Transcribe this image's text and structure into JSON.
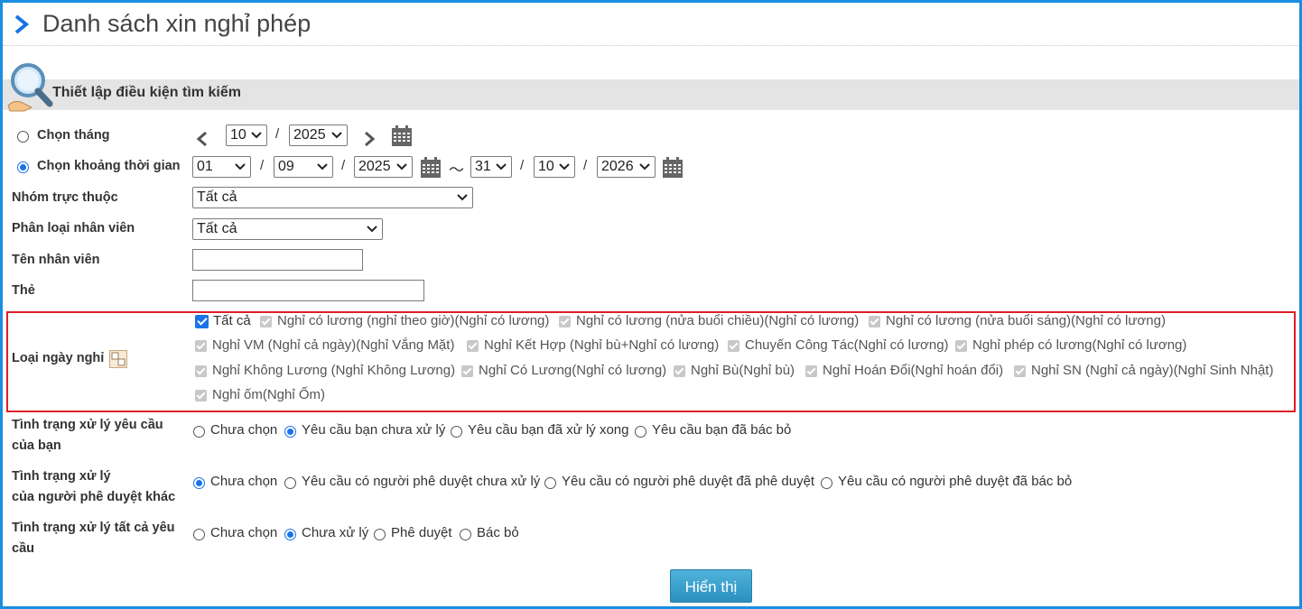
{
  "page": {
    "title": "Danh sách xin nghỉ phép",
    "section_title": "Thiết lập điều kiện tìm kiếm",
    "accent_color": "#1a8ee0",
    "highlight_color": "#e01e2a"
  },
  "month_mode": {
    "label": "Chọn tháng",
    "selected": false,
    "month": "10",
    "separator": "/",
    "year": "2025"
  },
  "range_mode": {
    "label": "Chọn khoảng thời gian",
    "selected": true,
    "from_day": "01",
    "from_month": "09",
    "from_year": "2025",
    "tilde": "～",
    "to_day": "31",
    "to_month": "10",
    "to_year": "2026",
    "separator": "/"
  },
  "group": {
    "label": "Nhóm trực thuộc",
    "value": "Tất cả"
  },
  "employee_type": {
    "label": "Phân loại nhân viên",
    "value": "Tất cả"
  },
  "employee_name": {
    "label": "Tên nhân viên",
    "value": ""
  },
  "card": {
    "label": "Thẻ",
    "value": ""
  },
  "leave_types": {
    "label": "Loại ngày nghỉ",
    "all_label": "Tất cả",
    "items": [
      "Nghỉ có lương (nghỉ theo giờ)(Nghỉ có lương)",
      "Nghỉ có lương (nửa buổi chiều)(Nghỉ có lương)",
      "Nghỉ có lương (nửa buổi sáng)(Nghỉ có lương)",
      "Nghỉ VM (Nghỉ cả ngày)(Nghỉ Vắng Mặt)",
      "Nghỉ Kết Hợp (Nghỉ bù+Nghỉ có lương)",
      "Chuyến Công Tác(Nghỉ có lương)",
      "Nghỉ phép có lương(Nghỉ có lương)",
      "Nghỉ Không Lương (Nghỉ Không Lương)",
      "Nghỉ Có Lương(Nghỉ có lương)",
      "Nghỉ Bù(Nghỉ bù)",
      "Nghỉ Hoán Đổi(Nghỉ hoán đổi)",
      "Nghỉ SN (Nghỉ cả ngày)(Nghỉ Sinh Nhật)",
      "Nghỉ ốm(Nghỉ Ốm)"
    ]
  },
  "my_status": {
    "label_line1": "Tình trạng xử lý yêu cầu",
    "label_line2": "của bạn",
    "options": [
      "Chưa chọn",
      "Yêu cầu bạn chưa xử lý",
      "Yêu cầu bạn đã xử lý xong",
      "Yêu cầu bạn đã bác bỏ"
    ],
    "selected_index": 1
  },
  "other_status": {
    "label_line1": "Tình trạng xử lý",
    "label_line2": "của người phê duyệt khác",
    "options": [
      "Chưa chọn",
      "Yêu cầu có người phê duyệt chưa xử lý",
      "Yêu cầu có người phê duyệt đã phê duyệt",
      "Yêu cầu có người phê duyệt đã bác bỏ"
    ],
    "selected_index": 0
  },
  "all_status": {
    "label_line1": "Tình trạng xử lý tất cả yêu",
    "label_line2": "cầu",
    "options": [
      "Chưa chọn",
      "Chưa xử lý",
      "Phê duyệt",
      "Bác bỏ"
    ],
    "selected_index": 1
  },
  "show_button": "Hiển thị"
}
